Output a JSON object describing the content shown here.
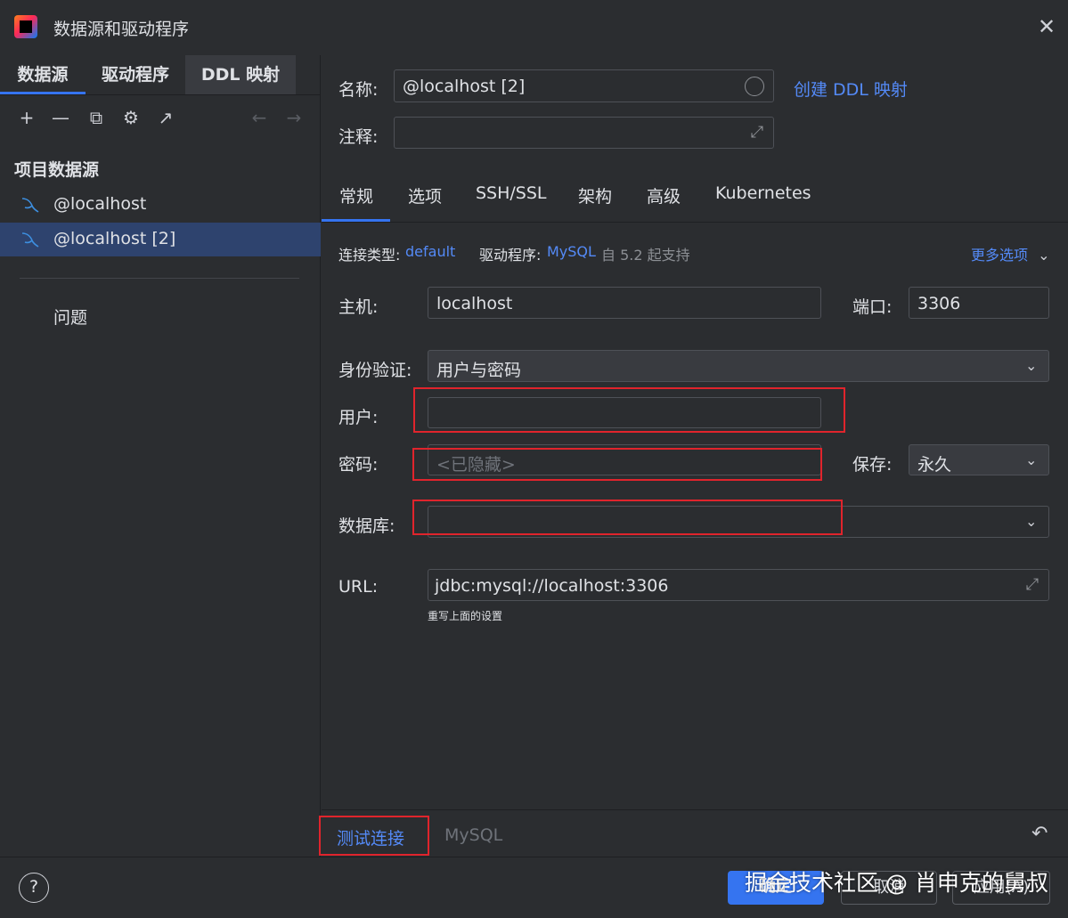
{
  "window": {
    "title": "数据源和驱动程序",
    "close_glyph": "✕"
  },
  "left": {
    "tabs": [
      "数据源",
      "驱动程序",
      "DDL 映射"
    ],
    "toolbar": {
      "add": "+",
      "remove": "—",
      "copy": "⧉",
      "settings": "⚙",
      "export": "↗",
      "back": "←",
      "forward": "→"
    },
    "section_title": "项目数据源",
    "items": [
      "@localhost",
      "@localhost [2]"
    ],
    "selected_index": 1,
    "problems": "问题"
  },
  "form": {
    "name_label": "名称:",
    "name_value": "@localhost [2]",
    "create_ddl_link": "创建 DDL 映射",
    "comment_label": "注释:",
    "comment_value": "",
    "tabs": [
      "常规",
      "选项",
      "SSH/SSL",
      "架构",
      "高级",
      "Kubernetes"
    ],
    "active_tab": "常规",
    "conn_type_label": "连接类型:",
    "conn_type_value": "default",
    "driver_label": "驱动程序:",
    "driver_value": "MySQL",
    "driver_note": "自 5.2 起支持",
    "more_options": "更多选项",
    "host_label": "主机:",
    "host_value": "localhost",
    "port_label": "端口:",
    "port_value": "3306",
    "auth_label": "身份验证:",
    "auth_value": "用户与密码",
    "user_label": "用户:",
    "user_value": "",
    "password_label": "密码:",
    "password_placeholder": "<已隐藏>",
    "save_label": "保存:",
    "save_value": "永久",
    "database_label": "数据库:",
    "database_value": "",
    "url_label": "URL:",
    "url_value": "jdbc:mysql://localhost:3306",
    "url_note": "重写上面的设置"
  },
  "bottom": {
    "test_connection": "测试连接",
    "driver_hint": "MySQL",
    "undo_glyph": "↶"
  },
  "footer": {
    "help": "?",
    "ok": "确定",
    "cancel": "取消",
    "apply": "应用(A)",
    "watermark": "掘金技术社区 @ 肖申克的舅叔"
  },
  "colors": {
    "accent": "#3574f0",
    "link": "#548af7",
    "highlight_box": "#e0242c",
    "selection": "#2e436e"
  }
}
